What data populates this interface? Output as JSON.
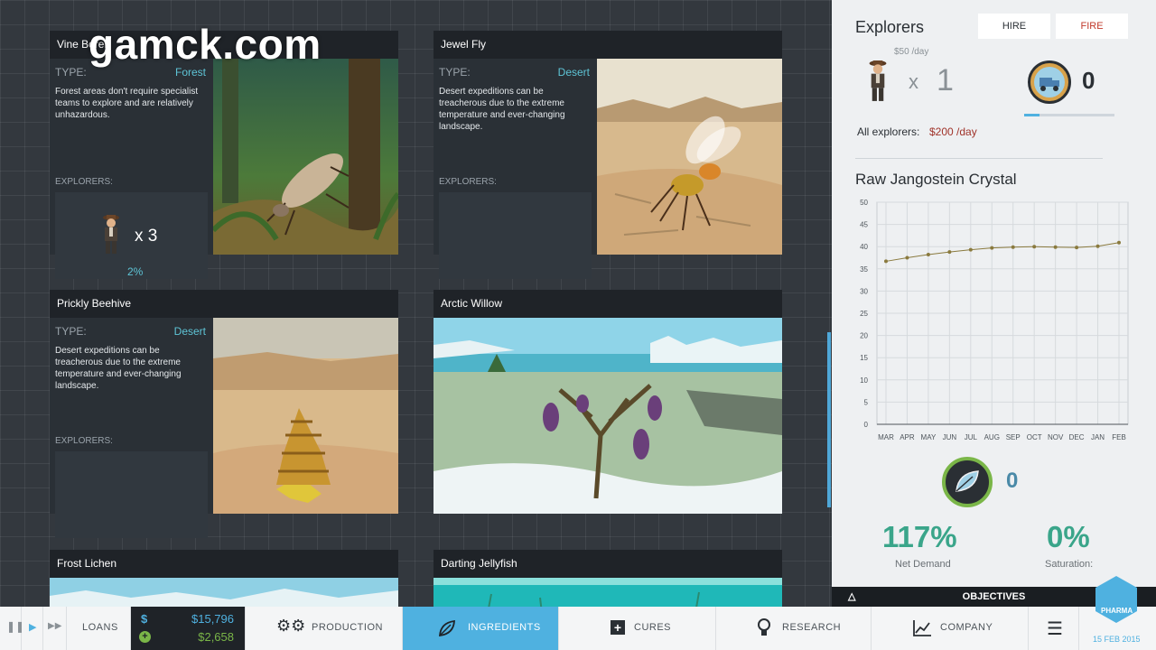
{
  "watermark": "gamck.com",
  "cards": [
    {
      "title": "Vine Borer",
      "type_label": "TYPE:",
      "type": "Forest",
      "description": "Forest areas don't require specialist teams to explore and are relatively unhazardous.",
      "explorers_label": "EXPLORERS:",
      "explorer_count": "x 3",
      "percent": "2%"
    },
    {
      "title": "Jewel Fly",
      "type_label": "TYPE:",
      "type": "Desert",
      "description": "Desert expeditions can be treacherous due to the extreme temperature and ever-changing landscape.",
      "explorers_label": "EXPLORERS:"
    },
    {
      "title": "Prickly Beehive",
      "type_label": "TYPE:",
      "type": "Desert",
      "description": "Desert expeditions can be treacherous due to the extreme temperature and ever-changing landscape.",
      "explorers_label": "EXPLORERS:"
    },
    {
      "title": "Arctic Willow"
    },
    {
      "title": "Frost Lichen"
    },
    {
      "title": "Darting Jellyfish"
    }
  ],
  "side": {
    "title": "Explorers",
    "hire_label": "HIRE",
    "fire_label": "FIRE",
    "cost": "$50 /day",
    "explorer_x": "x",
    "explorer_count": "1",
    "transport_count": "0",
    "transport_progress": 0.17,
    "all_label": "All explorers:",
    "all_value": "$200 /day",
    "ingredient_title": "Raw Jangostein Crystal",
    "leaf_count": "0",
    "net_demand": "117%",
    "net_demand_label": "Net Demand",
    "saturation": "0%",
    "saturation_label": "Saturation:",
    "objectives": "OBJECTIVES",
    "colors": {
      "accent": "#4fb1e0",
      "teal": "#3aa58a",
      "fire": "#c0392b",
      "leaf_ring": "#7ab648"
    }
  },
  "chart_data": {
    "type": "line",
    "title": "Raw Jangostein Crystal",
    "categories": [
      "MAR",
      "APR",
      "MAY",
      "JUN",
      "JUL",
      "AUG",
      "SEP",
      "OCT",
      "NOV",
      "DEC",
      "JAN",
      "FEB"
    ],
    "series": [
      {
        "values": [
          36.7,
          37.5,
          38.2,
          38.8,
          39.3,
          39.7,
          39.9,
          40.0,
          39.9,
          39.8,
          40.1,
          40.9
        ]
      }
    ],
    "yticks": [
      "0",
      "5",
      "10",
      "15",
      "20",
      "25",
      "30",
      "35",
      "40",
      "45",
      "50"
    ],
    "ylim": [
      0,
      50
    ],
    "grid": true,
    "color": "#8a7a3e"
  },
  "bottombar": {
    "loans": "LOANS",
    "money_symbol": "$",
    "money": "$15,796",
    "income": "$2,658",
    "production": "PRODUCTION",
    "ingredients": "INGREDIENTS",
    "cures": "CURES",
    "research": "RESEARCH",
    "company": "COMPANY",
    "logo_text": "PHARMA",
    "date": "15 FEB 2015"
  }
}
